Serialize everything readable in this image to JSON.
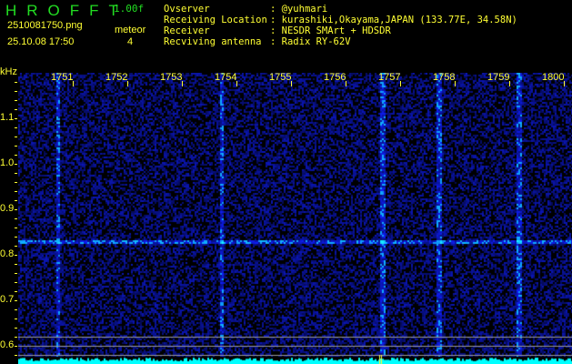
{
  "header": {
    "logo": "HROFFT",
    "version": "1.00f",
    "filename": "2510081750.png",
    "datetime": "25.10.08 17:50",
    "meteor_label": "meteor",
    "meteor_count": "4"
  },
  "info": [
    {
      "label": "Ovserver",
      "value": "@yuhmari"
    },
    {
      "label": "Receiving Location",
      "value": "kurashiki,Okayama,JAPAN (133.77E, 34.58N)"
    },
    {
      "label": "Receiver",
      "value": "NESDR SMArt + HDSDR"
    },
    {
      "label": "Recviving antenna",
      "value": "Radix RY-62V"
    }
  ],
  "axis": {
    "y_unit": "kHz",
    "x_ticks": [
      "1751",
      "1752",
      "1753",
      "1754",
      "1755",
      "1756",
      "1757",
      "1758",
      "1759",
      "1800"
    ],
    "y_ticks": [
      "1.1",
      "1.0",
      "0.9",
      "0.8",
      "0.7",
      "0.6"
    ]
  },
  "colors": {
    "text": "#ffff33",
    "logo": "#22dd22",
    "signal": "#2244ff",
    "spectrum": "#00ffff"
  }
}
